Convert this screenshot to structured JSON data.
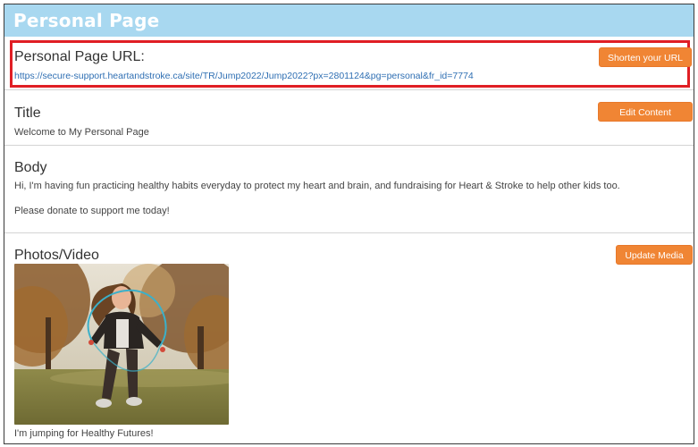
{
  "header": {
    "title": "Personal Page"
  },
  "url_section": {
    "heading": "Personal Page URL:",
    "url": "https://secure-support.heartandstroke.ca/site/TR/Jump2022/Jump2022?px=2801124&pg=personal&fr_id=7774",
    "button_label": "Shorten your URL"
  },
  "title_section": {
    "heading": "Title",
    "text": "Welcome to My Personal Page",
    "button_label": "Edit Content"
  },
  "body_section": {
    "heading": "Body",
    "paragraph1": "Hi, I'm having fun practicing healthy habits everyday to protect my heart and brain, and fundraising for Heart & Stroke to help other kids too.",
    "paragraph2": "Please donate to support me today!"
  },
  "media_section": {
    "heading": "Photos/Video",
    "button_label": "Update Media",
    "caption": "I'm jumping for Healthy Futures!"
  },
  "colors": {
    "header_bg": "#a8d8f0",
    "button": "#f08534",
    "highlight": "#e01e24",
    "link": "#2f6fb3"
  }
}
